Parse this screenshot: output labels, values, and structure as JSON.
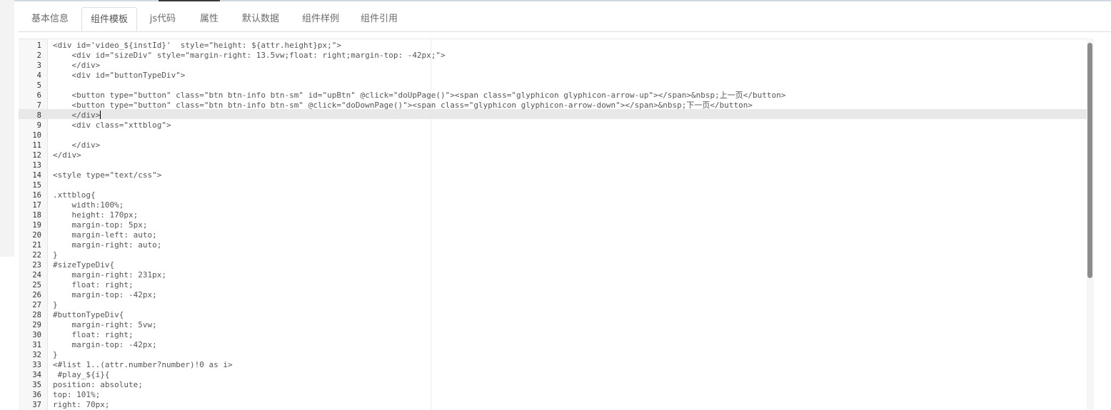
{
  "tabs": [
    {
      "label": "基本信息"
    },
    {
      "label": "组件模板"
    },
    {
      "label": "js代码"
    },
    {
      "label": "属性"
    },
    {
      "label": "默认数据"
    },
    {
      "label": "组件样例"
    },
    {
      "label": "组件引用"
    }
  ],
  "active_tab": "组件模板",
  "editor": {
    "active_line": 8,
    "lines": [
      {
        "n": "1",
        "text": "<div id='video_${instId}'  style=\"height: ${attr.height}px;\">"
      },
      {
        "n": "2",
        "text": "    <div id=\"sizeDiv\" style=\"margin-right: 13.5vw;float: right;margin-top: -42px;\">"
      },
      {
        "n": "3",
        "text": "    </div>"
      },
      {
        "n": "4",
        "text": "    <div id=\"buttonTypeDiv\">"
      },
      {
        "n": "5",
        "text": ""
      },
      {
        "n": "6",
        "text": "    <button type=\"button\" class=\"btn btn-info btn-sm\" id=\"upBtn\" @click=\"doUpPage()\"><span class=\"glyphicon glyphicon-arrow-up\"></span>&nbsp;上一页</button>"
      },
      {
        "n": "7",
        "text": "    <button type=\"button\" class=\"btn btn-info btn-sm\" @click=\"doDownPage()\"><span class=\"glyphicon glyphicon-arrow-down\"></span>&nbsp;下一页</button>"
      },
      {
        "n": "8",
        "text": "    </div>"
      },
      {
        "n": "9",
        "text": "    <div class=\"xttblog\">"
      },
      {
        "n": "10",
        "text": ""
      },
      {
        "n": "11",
        "text": "    </div>"
      },
      {
        "n": "12",
        "text": "</div>"
      },
      {
        "n": "13",
        "text": ""
      },
      {
        "n": "14",
        "text": "<style type=\"text/css\">"
      },
      {
        "n": "15",
        "text": ""
      },
      {
        "n": "16",
        "text": ".xttblog{"
      },
      {
        "n": "17",
        "text": "    width:100%;"
      },
      {
        "n": "18",
        "text": "    height: 170px;"
      },
      {
        "n": "19",
        "text": "    margin-top: 5px;"
      },
      {
        "n": "20",
        "text": "    margin-left: auto;"
      },
      {
        "n": "21",
        "text": "    margin-right: auto;"
      },
      {
        "n": "22",
        "text": "}"
      },
      {
        "n": "23",
        "text": "#sizeTypeDiv{"
      },
      {
        "n": "24",
        "text": "    margin-right: 231px;"
      },
      {
        "n": "25",
        "text": "    float: right;"
      },
      {
        "n": "26",
        "text": "    margin-top: -42px;"
      },
      {
        "n": "27",
        "text": "}"
      },
      {
        "n": "28",
        "text": "#buttonTypeDiv{"
      },
      {
        "n": "29",
        "text": "    margin-right: 5vw;"
      },
      {
        "n": "30",
        "text": "    float: right;"
      },
      {
        "n": "31",
        "text": "    margin-top: -42px;"
      },
      {
        "n": "32",
        "text": "}"
      },
      {
        "n": "33",
        "text": "<#list 1..(attr.number?number)!0 as i>"
      },
      {
        "n": "34",
        "text": " #play_${i}{"
      },
      {
        "n": "35",
        "text": "position: absolute;"
      },
      {
        "n": "36",
        "text": "top: 101%;"
      },
      {
        "n": "37",
        "text": "right: 70px;"
      }
    ]
  },
  "icons": {
    "text_cursor": "text-cursor-icon"
  }
}
